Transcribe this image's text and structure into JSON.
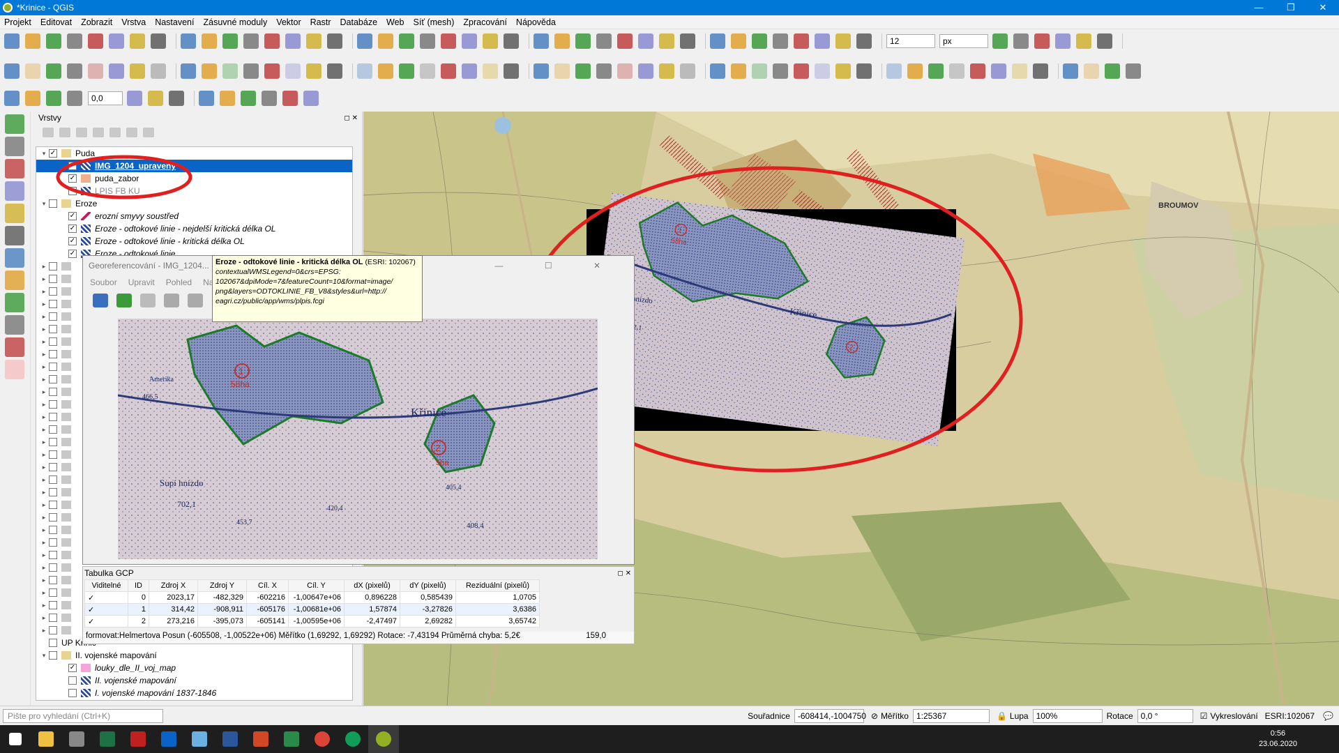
{
  "window": {
    "title": "*Krinice - QGIS"
  },
  "menu": [
    "Projekt",
    "Editovat",
    "Zobrazit",
    "Vrstva",
    "Nastavení",
    "Zásuvné moduly",
    "Vektor",
    "Rastr",
    "Databáze",
    "Web",
    "Síť (mesh)",
    "Zpracování",
    "Nápověda"
  ],
  "toolbar": {
    "font_size": "12",
    "unit": "px",
    "label_value": "0,0"
  },
  "layers_panel": {
    "title": "Vrstvy"
  },
  "tree": [
    {
      "label": "Puda",
      "indent": 0,
      "group": true,
      "checked": true
    },
    {
      "label": "IMG_1204_upravený",
      "indent": 2,
      "checked": true,
      "selected": true,
      "sym": "raster"
    },
    {
      "label": "puda_zabor",
      "indent": 2,
      "checked": true,
      "sym": "fill",
      "color": "#f0b090"
    },
    {
      "label": "LPIS FB KU",
      "indent": 2,
      "checked": false,
      "sym": "raster",
      "faded": true
    },
    {
      "label": "Eroze",
      "indent": 0,
      "group": true,
      "checked": false
    },
    {
      "label": "erozní smyvy soustřed",
      "indent": 2,
      "checked": true,
      "sym": "line",
      "italic": true
    },
    {
      "label": "Eroze - odtokové linie - nejdelší kritická délka OL",
      "indent": 2,
      "checked": true,
      "sym": "raster",
      "italic": true
    },
    {
      "label": "Eroze - odtokové linie - kritická délka OL",
      "indent": 2,
      "checked": true,
      "sym": "raster",
      "italic": true
    },
    {
      "label": "Eroze - odtokové linie",
      "indent": 2,
      "checked": true,
      "sym": "raster",
      "italic": true
    }
  ],
  "tree_bottom": [
    {
      "label": "UP Krinic",
      "indent": 0,
      "checked": false
    },
    {
      "label": "II. vojenské mapování",
      "indent": 0,
      "group": true,
      "checked": false
    },
    {
      "label": "louky_dle_II_voj_map",
      "indent": 2,
      "checked": true,
      "sym": "fill",
      "color": "#f4a6d8",
      "italic": true
    },
    {
      "label": "II. vojenské mapování",
      "indent": 2,
      "checked": false,
      "sym": "raster",
      "italic": true
    },
    {
      "label": "I. vojenské mapování 1837-1846",
      "indent": 2,
      "checked": false,
      "sym": "raster",
      "italic": true
    }
  ],
  "georef": {
    "title": "Georeferencování - IMG_1204...",
    "menu": [
      "Soubor",
      "Upravit",
      "Pohled",
      "Nastavení"
    ]
  },
  "tooltip": {
    "title": "Eroze - odtokové linie - kritická délka OL",
    "title_suffix": "(ESRI: 102067)",
    "body": "contextualWMSLegend=0&crs=EPSG: 102067&dpiMode=7&featureCount=10&format=image/ png&layers=ODTOKLINIE_FB_V8&styles&url=http:// eagri.cz/public/app/wms/plpis.fcgi"
  },
  "gcp": {
    "title": "Tabulka GCP",
    "headers": [
      "Viditelné",
      "ID",
      "Zdroj X",
      "Zdroj Y",
      "Cíl. X",
      "Cíl. Y",
      "dX (pixelů)",
      "dY (pixelů)",
      "Reziduální (pixelů)"
    ],
    "rows": [
      [
        "✓",
        "0",
        "2023,17",
        "-482,329",
        "-602216",
        "-1,00647e+06",
        "0,896228",
        "0,585439",
        "1,0705"
      ],
      [
        "✓",
        "1",
        "314,42",
        "-908,911",
        "-605176",
        "-1,00681e+06",
        "1,57874",
        "-3,27826",
        "3,6386"
      ],
      [
        "✓",
        "2",
        "273,216",
        "-395,073",
        "-605141",
        "-1,00595e+06",
        "-2,47497",
        "2,69282",
        "3,65742"
      ]
    ],
    "status": "formovat:Helmertova Posun (-605508, -1,00522e+06) Měřítko (1,69292, 1,69292) Rotace: -7,43194 Průměrná chyba: 5,2€",
    "coord": "159,0"
  },
  "map_labels": {
    "broumov": "BROUMOV",
    "krinice": "Křinice",
    "supi": "Supí hnízdo",
    "elev1": "702,1",
    "elev2": "466,5",
    "elev3": "405,4",
    "elev4": "408,4",
    "elev5": "453,7",
    "elev6": "420,4",
    "num1": "1",
    "num2": "2",
    "ha1": "58ha",
    "ha2": "5ha",
    "amerika": "Amerika"
  },
  "status": {
    "search": "Pište pro vyhledání (Ctrl+K)",
    "coord_label": "Souřadnice",
    "coord": "-608414,-1004750",
    "scale_label": "Měřítko",
    "scale": "1:25367",
    "mag_label": "Lupa",
    "mag": "100%",
    "rot_label": "Rotace",
    "rot": "0,0 °",
    "render": "Vykreslování",
    "crs": "ESRI:102067"
  },
  "clock": {
    "time": "0:56",
    "date": "23.06.2020"
  },
  "colors": {
    "accent": "#0078d7",
    "annotation": "#e02020",
    "selection": "#0a64c8"
  }
}
